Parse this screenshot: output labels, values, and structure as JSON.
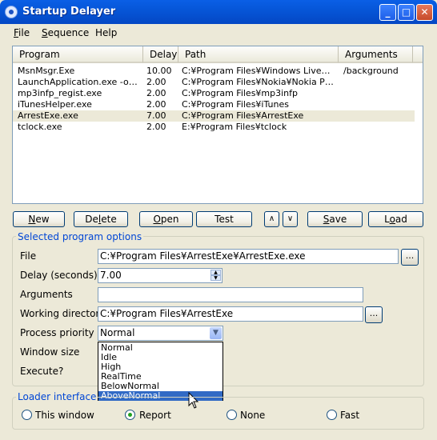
{
  "window": {
    "title": "Startup Delayer",
    "min": "_",
    "max": "□",
    "close": "✕"
  },
  "menu": [
    "File",
    "Sequence",
    "Help"
  ],
  "columns": [
    "Program",
    "Delay",
    "Path",
    "Arguments"
  ],
  "rows": [
    {
      "program": "MsnMsgr.Exe",
      "delay": "10.00",
      "path": "C:¥Program Files¥Windows Live¥Mes...",
      "args": "/background"
    },
    {
      "program": "LaunchApplication.exe -onlytray",
      "delay": "2.00",
      "path": "C:¥Program Files¥Nokia¥Nokia PC S...",
      "args": ""
    },
    {
      "program": "mp3infp_regist.exe",
      "delay": "2.00",
      "path": "C:¥Program Files¥mp3infp",
      "args": ""
    },
    {
      "program": "iTunesHelper.exe",
      "delay": "2.00",
      "path": "C:¥Program Files¥iTunes",
      "args": ""
    },
    {
      "program": "ArrestExe.exe",
      "delay": "7.00",
      "path": "C:¥Program Files¥ArrestExe",
      "args": ""
    },
    {
      "program": "tclock.exe",
      "delay": "2.00",
      "path": "E:¥Program Files¥tclock",
      "args": ""
    }
  ],
  "buttons": {
    "new": "New",
    "delete": "Delete",
    "open": "Open",
    "test": "Test",
    "up": "∧",
    "down": "∨",
    "save": "Save",
    "load": "Load"
  },
  "options": {
    "legend": "Selected program options",
    "file_label": "File",
    "file_value": "C:¥Program Files¥ArrestExe¥ArrestExe.exe",
    "delay_label": "Delay (seconds)",
    "delay_value": "7.00",
    "args_label": "Arguments",
    "args_value": "",
    "workdir_label": "Working directory",
    "workdir_value": "C:¥Program Files¥ArrestExe",
    "priority_label": "Process priority",
    "priority_value": "Normal",
    "priority_options": [
      "Normal",
      "Idle",
      "High",
      "RealTime",
      "BelowNormal",
      "AboveNormal"
    ],
    "window_size_label": "Window size",
    "execute_label": "Execute?",
    "browse": "..."
  },
  "loader": {
    "legend": "Loader interface",
    "options": [
      "This window",
      "Report",
      "None",
      "Fast"
    ],
    "selected": "Report"
  }
}
